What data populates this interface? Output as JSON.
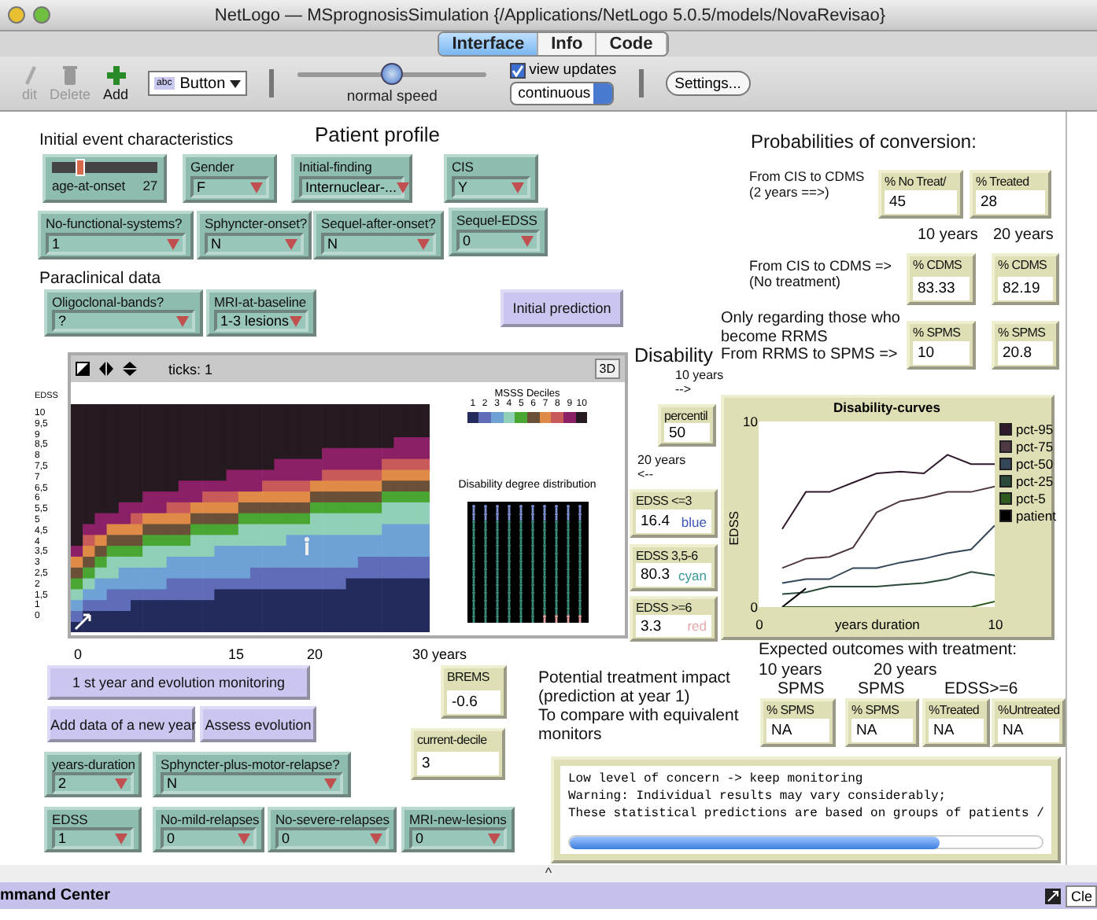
{
  "window": {
    "title": "NetLogo — MSprognosisSimulation {/Applications/NetLogo 5.0.5/models/NovaRevisao}"
  },
  "tabs": [
    {
      "label": "Interface",
      "selected": true
    },
    {
      "label": "Info",
      "selected": false
    },
    {
      "label": "Code",
      "selected": false
    }
  ],
  "toolbar": {
    "tools": [
      {
        "kind": "edit",
        "label": "dit",
        "disabled": true
      },
      {
        "kind": "delete",
        "label": "Delete",
        "disabled": true
      },
      {
        "kind": "add",
        "label": "Add",
        "disabled": false
      }
    ],
    "widget_icon_text": "abc",
    "widget_type": "Button",
    "speed": {
      "label": "normal speed",
      "level": 0.5
    },
    "view_updates": {
      "label": "view updates",
      "checked": true
    },
    "update_mode": "continuous",
    "settings": "Settings..."
  },
  "labels": [
    "Initial event characteristics",
    "Patient profile",
    "Paraclinical data",
    "Probabilities of conversion:",
    "From CIS to CDMS\n(2 years ==>)",
    "10 years",
    "20 years",
    "From CIS to CDMS =>\n(No treatment)",
    "Disability",
    "Only regarding those who\nbecome RRMS\nFrom RRMS to SPMS =>",
    "10 years\n-->",
    "20 years\n<--",
    "Expected outcomes with treatment:",
    "10 years",
    "20 years",
    "SPMS",
    "SPMS",
    "EDSS>=6",
    "Potential treatment impact\n(prediction at year 1)\nTo compare with equivalent\nmonitors"
  ],
  "sliders": [
    {
      "label": "age-at-onset",
      "value": "27",
      "level": 0.27
    }
  ],
  "choosers": [
    {
      "label": "Gender",
      "value": "F"
    },
    {
      "label": "Initial-finding",
      "value": "Internuclear-..."
    },
    {
      "label": "CIS",
      "value": "Y"
    },
    {
      "label": "No-functional-systems?",
      "value": "1"
    },
    {
      "label": "Sphyncter-onset?",
      "value": "N"
    },
    {
      "label": "Sequel-after-onset?",
      "value": "N"
    },
    {
      "label": "Sequel-EDSS",
      "value": "0"
    },
    {
      "label": "Oligoclonal-bands?",
      "value": "?"
    },
    {
      "label": "MRI-at-baseline",
      "value": "1-3 lesions"
    },
    {
      "label": "years-duration",
      "value": "2"
    },
    {
      "label": "Sphyncter-plus-motor-relapse?",
      "value": "N"
    },
    {
      "label": "EDSS",
      "value": "1"
    },
    {
      "label": "No-mild-relapses",
      "value": "0"
    },
    {
      "label": "No-severe-relapses",
      "value": "0"
    },
    {
      "label": "MRI-new-lesions",
      "value": "0"
    }
  ],
  "buttons": [
    "Initial prediction",
    "1 st year and evolution monitoring",
    "Add data of a new year",
    "Assess evolution"
  ],
  "monitors": [
    {
      "label": "% No Treat/",
      "value": "45"
    },
    {
      "label": "% Treated",
      "value": "28"
    },
    {
      "label": "% CDMS",
      "value": "83.33"
    },
    {
      "label": "% CDMS",
      "value": "82.19"
    },
    {
      "label": "% SPMS",
      "value": "10"
    },
    {
      "label": "% SPMS",
      "value": "20.8"
    },
    {
      "label": "percentil",
      "value": "50"
    },
    {
      "label": "EDSS <=3",
      "value": "16.4",
      "note": "blue",
      "color": "#3b55b8"
    },
    {
      "label": "EDSS 3,5-6",
      "value": "80.3",
      "note": "cyan",
      "color": "#3a9a9a"
    },
    {
      "label": "EDSS >=6",
      "value": "3.3",
      "note": "red",
      "color": "#e8a8a8"
    },
    {
      "label": "BREMS",
      "value": "-0.6"
    },
    {
      "label": "current-decile",
      "value": "3"
    },
    {
      "label": "% SPMS",
      "value": "NA"
    },
    {
      "label": "% SPMS",
      "value": "NA"
    },
    {
      "label": "%Treated",
      "value": "NA"
    },
    {
      "label": "%Untreated",
      "value": "NA"
    }
  ],
  "view": {
    "ticks": "ticks: 1",
    "three_d": "3D",
    "y_axis_title": "EDSS",
    "y_labels": [
      "10",
      "9,5",
      "9",
      "8,5",
      "8",
      "7,5",
      "7",
      "6,5",
      "6",
      "5,5",
      "5",
      "4,5",
      "4",
      "3,5",
      "3",
      "2,5",
      "2",
      "1,5",
      "1",
      "0"
    ],
    "x_labels": [
      "0",
      "15",
      "20",
      "30 years"
    ],
    "legend_title": "MSSS Deciles",
    "deciles": [
      {
        "label": "1",
        "color": "#232a5c"
      },
      {
        "label": "2",
        "color": "#5f6db8"
      },
      {
        "label": "3",
        "color": "#6ea2d6"
      },
      {
        "label": "4",
        "color": "#8fd0b6"
      },
      {
        "label": "5",
        "color": "#4aa632"
      },
      {
        "label": "6",
        "color": "#6a5036"
      },
      {
        "label": "7",
        "color": "#e08a48"
      },
      {
        "label": "8",
        "color": "#c85a5a"
      },
      {
        "label": "9",
        "color": "#8c2066"
      },
      {
        "label": "10",
        "color": "#261a21"
      }
    ],
    "distribution_title": "Disability degree distribution"
  },
  "plot": {
    "chart_data": {
      "type": "line",
      "title": "Disability-curves",
      "xlabel": "years duration",
      "ylabel": "EDSS",
      "x": [
        1,
        2,
        3,
        4,
        5,
        6,
        7,
        8,
        9,
        10
      ],
      "legend": "right",
      "xlim": [
        0,
        10
      ],
      "ylim": [
        0,
        10
      ],
      "xticks": [
        0,
        10
      ],
      "yticks": [
        0,
        10
      ],
      "series": [
        {
          "name": "pct-95",
          "color": "#2e1a2c",
          "values": [
            4.2,
            6.2,
            6.2,
            6.7,
            7.2,
            7.3,
            7.2,
            8.2,
            7.7,
            7.7
          ]
        },
        {
          "name": "pct-75",
          "color": "#4d3844",
          "values": [
            2.1,
            2.6,
            2.7,
            3.2,
            5.1,
            5.7,
            5.9,
            6.2,
            6.2,
            6.5
          ]
        },
        {
          "name": "pct-50",
          "color": "#34475a",
          "values": [
            1.3,
            1.5,
            1.5,
            2.1,
            2.1,
            2.4,
            2.6,
            2.9,
            3.1,
            4.4
          ]
        },
        {
          "name": "pct-25",
          "color": "#2c4a3a",
          "values": [
            0.7,
            0.8,
            1.1,
            1.1,
            1.1,
            1.2,
            1.3,
            1.5,
            1.9,
            1.7
          ]
        },
        {
          "name": "pct-5",
          "color": "#2e5a1e",
          "values": [
            0,
            0,
            0,
            0,
            0,
            0,
            0,
            0,
            0,
            0.3
          ]
        },
        {
          "name": "patient",
          "color": "#000000",
          "values": [
            0,
            1,
            null,
            null,
            null,
            null,
            null,
            null,
            null,
            null
          ]
        }
      ]
    }
  },
  "output": {
    "lines": [
      "Low level of concern -> keep monitoring",
      "Warning: Individual results may vary considerably;",
      "These statistical predictions are based on groups of patients /"
    ]
  },
  "divider_handle": "^",
  "command_center": {
    "title": "mmand Center",
    "clear": "Cle"
  }
}
